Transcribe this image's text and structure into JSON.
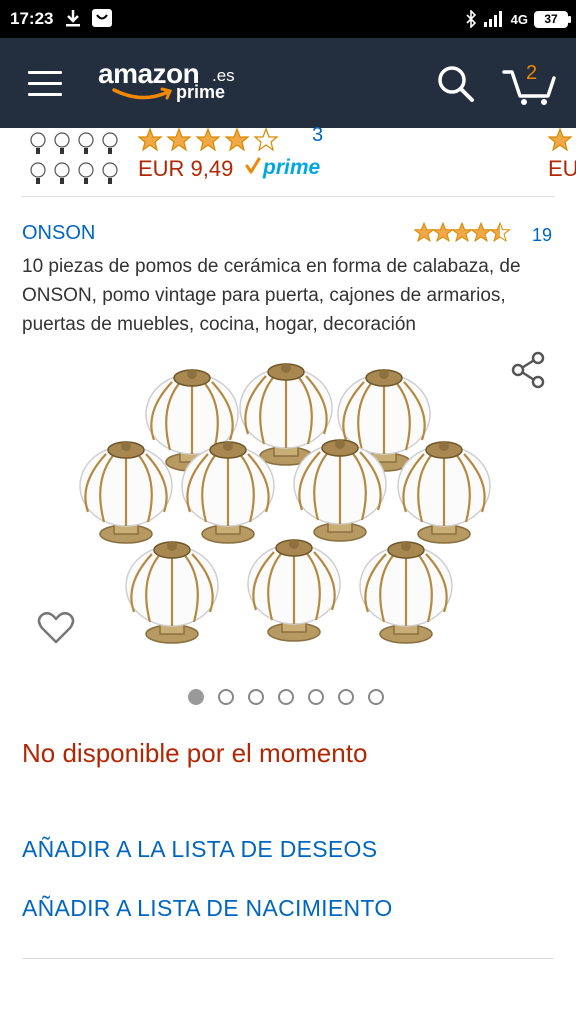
{
  "status_bar": {
    "time": "17:23",
    "network": "4G",
    "battery": "37",
    "icons": [
      "download-icon",
      "notification-icon",
      "bluetooth-icon",
      "signal-icon",
      "battery-icon"
    ]
  },
  "header": {
    "logo_text": "amazon",
    "logo_tld": ".es",
    "logo_sub": "prime",
    "cart_count": "2",
    "icons": [
      "menu-icon",
      "search-icon",
      "cart-icon"
    ],
    "colors": {
      "background": "#232f3e",
      "accent": "#f08804"
    }
  },
  "strip": {
    "rating_stars": 4,
    "review_count": "3",
    "price": "EUR 9,49",
    "prime_label": "prime",
    "next_price_partial": "EU"
  },
  "product": {
    "brand": "ONSON",
    "rating_stars": 4.5,
    "review_count": "19",
    "title": "10 piezas de pomos de cerámica en forma de calabaza, de ONSON, pomo vintage para puerta, cajones de armarios, puertas de muebles, cocina, hogar, decoración",
    "image_icons": [
      "share-icon",
      "heart-icon"
    ],
    "carousel": {
      "total": 7,
      "active": 1
    },
    "availability": "No disponible por el momento",
    "actions": {
      "wishlist": "AÑADIR A LA LISTA DE DESEOS",
      "baby_registry": "AÑADIR A LISTA DE NACIMIENTO"
    }
  },
  "colors": {
    "link": "#0066c0",
    "price": "#b12704",
    "star": "#f3a847"
  }
}
